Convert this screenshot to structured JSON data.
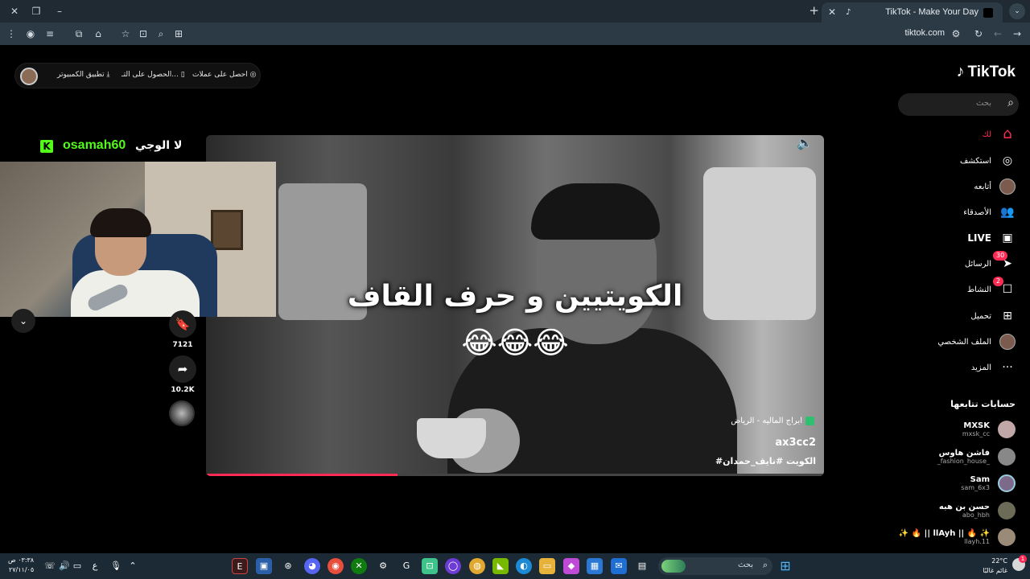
{
  "browser": {
    "tab_title": "TikTok - Make Your Day",
    "url": "tiktok.com",
    "new_tab": "+",
    "tab_close": "✕"
  },
  "pill": {
    "item1": "احصل على عملات",
    "item2": "الحصول على التـ...",
    "item3": "تطبيق الكمبيوتر"
  },
  "logo": "TikTok",
  "search": {
    "placeholder": "بحث"
  },
  "nav": {
    "foryou": "لك",
    "explore": "استكشف",
    "following": "أتابعه",
    "friends": "الأصدقاء",
    "live": "LIVE",
    "messages": "الرسائل",
    "messages_badge": "30",
    "activity": "النشاط",
    "activity_badge": "2",
    "upload": "تحميل",
    "profile": "الملف الشخصي",
    "more": "المزيد"
  },
  "following_accounts": {
    "title": "حسابات تتابعها",
    "items": [
      {
        "name": "MXSK",
        "username": "mxsk_cc"
      },
      {
        "name": "فاشن هاوس",
        "username": "_fashion_house_"
      },
      {
        "name": "Sam",
        "username": "sam_6x3"
      },
      {
        "name": "حسن بن هبه",
        "username": "abo_hbh"
      },
      {
        "name": "✨ 🔥 || llAyh || 🔥 ✨",
        "username": "llayh.11"
      }
    ]
  },
  "stream": {
    "kick_letter": "K",
    "username": "osamah60",
    "title": "لا الوجي"
  },
  "video": {
    "caption": "الكويتيين و حرف القاف",
    "emojis": "😂😂😂",
    "location": "ابراج الماليه - الرياض",
    "author": "ax3cc2",
    "description": "#الكويت #نايف_حمدان",
    "progress": 0.31
  },
  "actions": {
    "saves": "7121",
    "shares": "10.2K"
  },
  "taskbar": {
    "time": "٠٣:٣٨ ص",
    "date": "٢٧/١١/٠٥",
    "search_label": "بحث",
    "lang": "ع",
    "temperature": "22°C",
    "weather_desc": "غائم غالبًا",
    "weather_badge": "1"
  }
}
